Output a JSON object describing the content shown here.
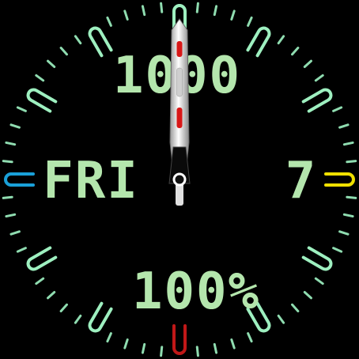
{
  "watch_face": {
    "steps": "1000",
    "weekday": "FRI",
    "day": "7",
    "battery": "100%",
    "colors": {
      "background": "#000000",
      "digits": "#b4e6ad",
      "markers": "#9ef0c0",
      "ticks": "#8fdcb0",
      "left_marker": "#1aa0d8",
      "right_marker": "#f0e000",
      "bottom_marker": "#c01818",
      "hand_body": "#e8e8e8",
      "hand_accent": "#d81818"
    },
    "icons": {
      "hour_marker": "hour-marker-icon",
      "hand": "clock-hand-icon"
    }
  }
}
